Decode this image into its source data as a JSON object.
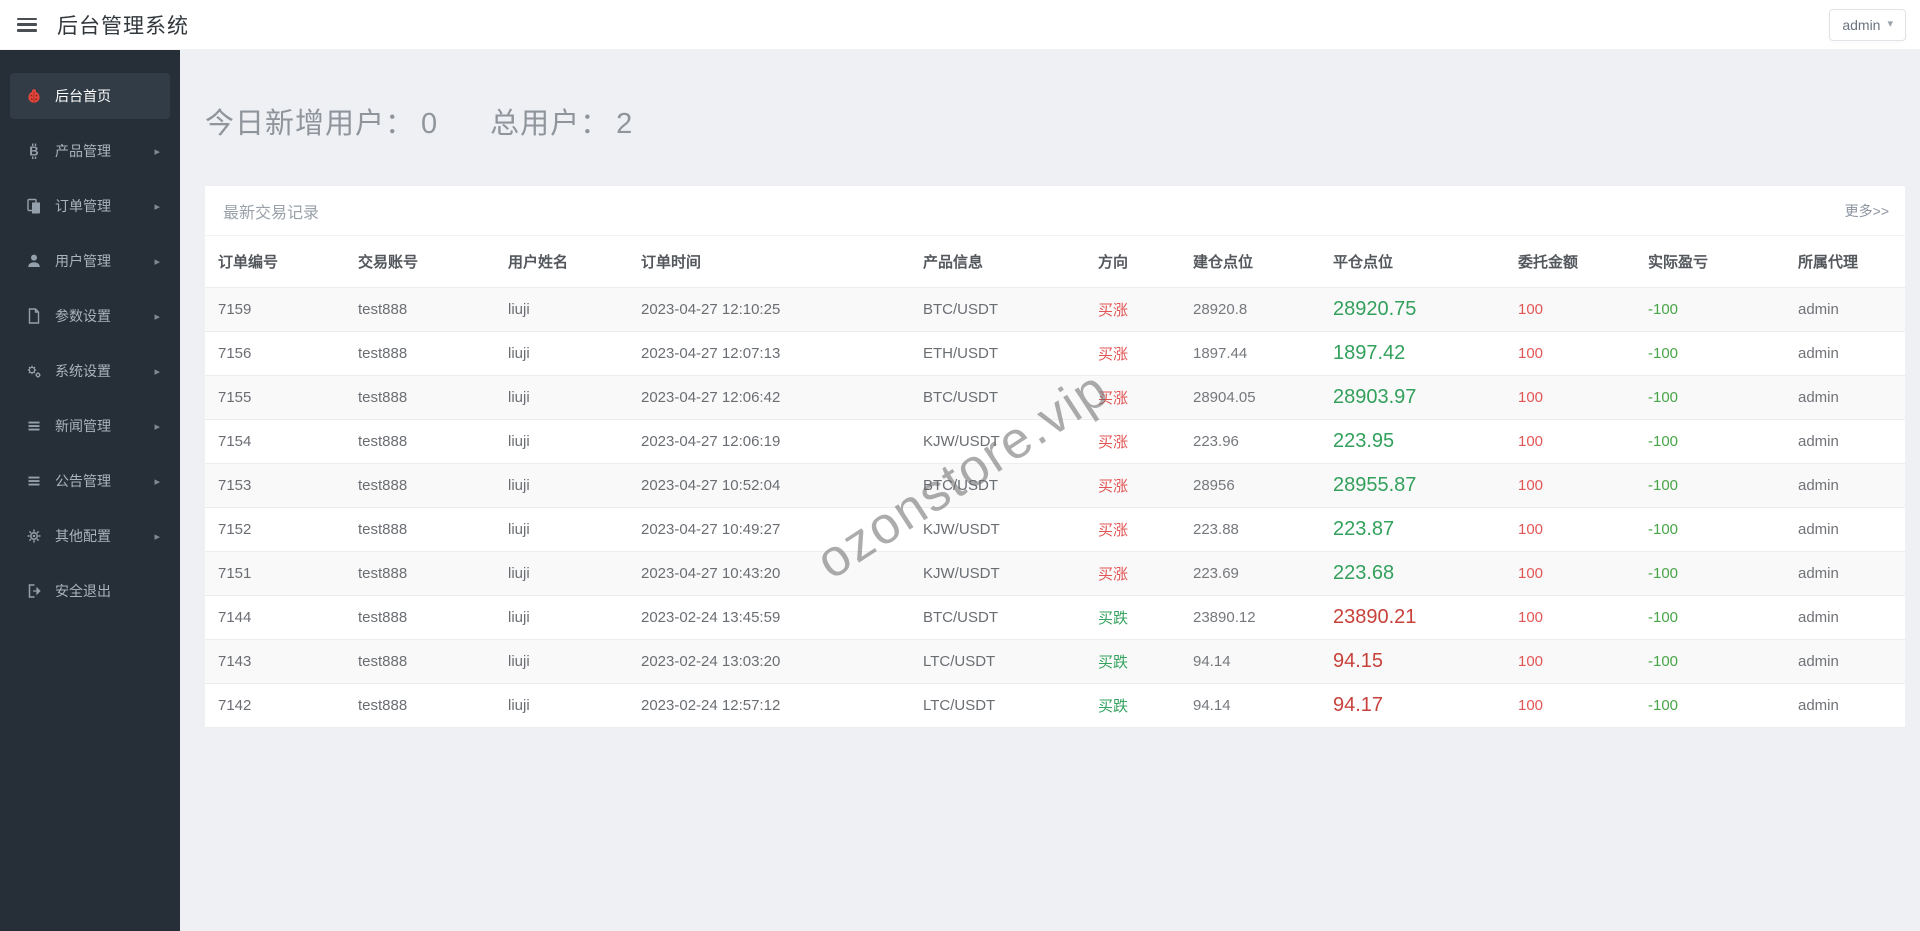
{
  "header": {
    "title": "后台管理系统",
    "user_menu": {
      "label": "admin",
      "caret_icon": "caret-down-icon"
    }
  },
  "sidebar": {
    "items": [
      {
        "label": "后台首页",
        "icon": "dashboard-icon",
        "active": true,
        "has_submenu": false
      },
      {
        "label": "产品管理",
        "icon": "bitcoin-icon",
        "active": false,
        "has_submenu": true
      },
      {
        "label": "订单管理",
        "icon": "files-icon",
        "active": false,
        "has_submenu": true
      },
      {
        "label": "用户管理",
        "icon": "user-icon",
        "active": false,
        "has_submenu": true
      },
      {
        "label": "参数设置",
        "icon": "document-icon",
        "active": false,
        "has_submenu": true
      },
      {
        "label": "系统设置",
        "icon": "gears-icon",
        "active": false,
        "has_submenu": true
      },
      {
        "label": "新闻管理",
        "icon": "list-icon",
        "active": false,
        "has_submenu": true
      },
      {
        "label": "公告管理",
        "icon": "list-icon",
        "active": false,
        "has_submenu": true
      },
      {
        "label": "其他配置",
        "icon": "gear-icon",
        "active": false,
        "has_submenu": true
      },
      {
        "label": "安全退出",
        "icon": "logout-icon",
        "active": false,
        "has_submenu": false
      }
    ],
    "submenu_arrow_icon": "chevron-right-icon"
  },
  "stats": {
    "new_users_label": "今日新增用户：",
    "new_users_value": "0",
    "total_users_label": "总用户：",
    "total_users_value": "2"
  },
  "panel": {
    "title": "最新交易记录",
    "more_label": "更多>>"
  },
  "table": {
    "columns": [
      "订单编号",
      "交易账号",
      "用户姓名",
      "订单时间",
      "产品信息",
      "方向",
      "建仓点位",
      "平仓点位",
      "委托金额",
      "实际盈亏",
      "所属代理"
    ],
    "rows": [
      {
        "order_id": "7159",
        "account": "test888",
        "username": "liuji",
        "time": "2023-04-27 12:10:25",
        "product": "BTC/USDT",
        "direction": "买涨",
        "direction_color": "red",
        "open_price": "28920.8",
        "close_price": "28920.75",
        "close_color": "green",
        "amount": "100",
        "pnl": "-100",
        "agent": "admin"
      },
      {
        "order_id": "7156",
        "account": "test888",
        "username": "liuji",
        "time": "2023-04-27 12:07:13",
        "product": "ETH/USDT",
        "direction": "买涨",
        "direction_color": "red",
        "open_price": "1897.44",
        "close_price": "1897.42",
        "close_color": "green",
        "amount": "100",
        "pnl": "-100",
        "agent": "admin"
      },
      {
        "order_id": "7155",
        "account": "test888",
        "username": "liuji",
        "time": "2023-04-27 12:06:42",
        "product": "BTC/USDT",
        "direction": "买涨",
        "direction_color": "red",
        "open_price": "28904.05",
        "close_price": "28903.97",
        "close_color": "green",
        "amount": "100",
        "pnl": "-100",
        "agent": "admin"
      },
      {
        "order_id": "7154",
        "account": "test888",
        "username": "liuji",
        "time": "2023-04-27 12:06:19",
        "product": "KJW/USDT",
        "direction": "买涨",
        "direction_color": "red",
        "open_price": "223.96",
        "close_price": "223.95",
        "close_color": "green",
        "amount": "100",
        "pnl": "-100",
        "agent": "admin"
      },
      {
        "order_id": "7153",
        "account": "test888",
        "username": "liuji",
        "time": "2023-04-27 10:52:04",
        "product": "BTC/USDT",
        "direction": "买涨",
        "direction_color": "red",
        "open_price": "28956",
        "close_price": "28955.87",
        "close_color": "green",
        "amount": "100",
        "pnl": "-100",
        "agent": "admin"
      },
      {
        "order_id": "7152",
        "account": "test888",
        "username": "liuji",
        "time": "2023-04-27 10:49:27",
        "product": "KJW/USDT",
        "direction": "买涨",
        "direction_color": "red",
        "open_price": "223.88",
        "close_price": "223.87",
        "close_color": "green",
        "amount": "100",
        "pnl": "-100",
        "agent": "admin"
      },
      {
        "order_id": "7151",
        "account": "test888",
        "username": "liuji",
        "time": "2023-04-27 10:43:20",
        "product": "KJW/USDT",
        "direction": "买涨",
        "direction_color": "red",
        "open_price": "223.69",
        "close_price": "223.68",
        "close_color": "green",
        "amount": "100",
        "pnl": "-100",
        "agent": "admin"
      },
      {
        "order_id": "7144",
        "account": "test888",
        "username": "liuji",
        "time": "2023-02-24 13:45:59",
        "product": "BTC/USDT",
        "direction": "买跌",
        "direction_color": "green",
        "open_price": "23890.12",
        "close_price": "23890.21",
        "close_color": "red",
        "amount": "100",
        "pnl": "-100",
        "agent": "admin"
      },
      {
        "order_id": "7143",
        "account": "test888",
        "username": "liuji",
        "time": "2023-02-24 13:03:20",
        "product": "LTC/USDT",
        "direction": "买跌",
        "direction_color": "green",
        "open_price": "94.14",
        "close_price": "94.15",
        "close_color": "red",
        "amount": "100",
        "pnl": "-100",
        "agent": "admin"
      },
      {
        "order_id": "7142",
        "account": "test888",
        "username": "liuji",
        "time": "2023-02-24 12:57:12",
        "product": "LTC/USDT",
        "direction": "买跌",
        "direction_color": "green",
        "open_price": "94.14",
        "close_price": "94.17",
        "close_color": "red",
        "amount": "100",
        "pnl": "-100",
        "agent": "admin"
      }
    ]
  },
  "watermark": {
    "text": "ozonstore.vip"
  },
  "colors": {
    "direction_red": "#e25555",
    "direction_green": "#35a35f",
    "value_red": "#c8423c",
    "value_green": "#33a05c",
    "amount_red": "#e25555",
    "pnl_green": "#47a447",
    "sidebar_bg": "#262e37",
    "sidebar_active_bg": "#323c46",
    "dashboard_icon_red": "#e0473d",
    "page_bg": "#eef0f4"
  }
}
